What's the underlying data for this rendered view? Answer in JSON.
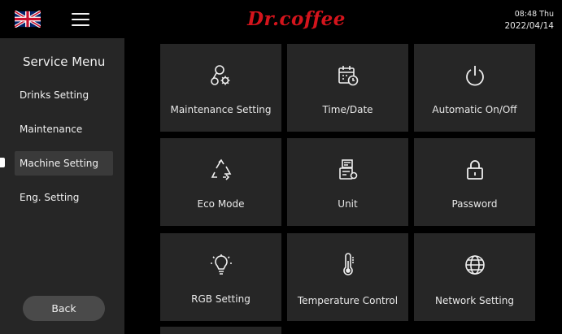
{
  "header": {
    "brand": "Dr.coffee",
    "time": "08:48 Thu",
    "date": "2022/04/14"
  },
  "sidebar": {
    "title": "Service Menu",
    "items": [
      {
        "label": "Drinks Setting"
      },
      {
        "label": "Maintenance"
      },
      {
        "label": "Machine Setting",
        "active": true
      },
      {
        "label": "Eng. Setting"
      }
    ],
    "back_label": "Back"
  },
  "tiles": [
    {
      "label": "Maintenance Setting",
      "icon": "maintenance-icon"
    },
    {
      "label": "Time/Date",
      "icon": "calendar-clock-icon"
    },
    {
      "label": "Automatic On/Off",
      "icon": "power-icon"
    },
    {
      "label": "Eco Mode",
      "icon": "recycle-icon"
    },
    {
      "label": "Unit",
      "icon": "unit-icon"
    },
    {
      "label": "Password",
      "icon": "lock-icon"
    },
    {
      "label": "RGB Setting",
      "icon": "lightbulb-icon"
    },
    {
      "label": "Temperature Control",
      "icon": "thermometer-icon"
    },
    {
      "label": "Network Setting",
      "icon": "globe-icon"
    }
  ],
  "colors": {
    "brand": "#d4141c",
    "tile_bg": "#262626",
    "active_item_bg": "#3a3a3a",
    "back_button_bg": "#4a4a4a"
  }
}
